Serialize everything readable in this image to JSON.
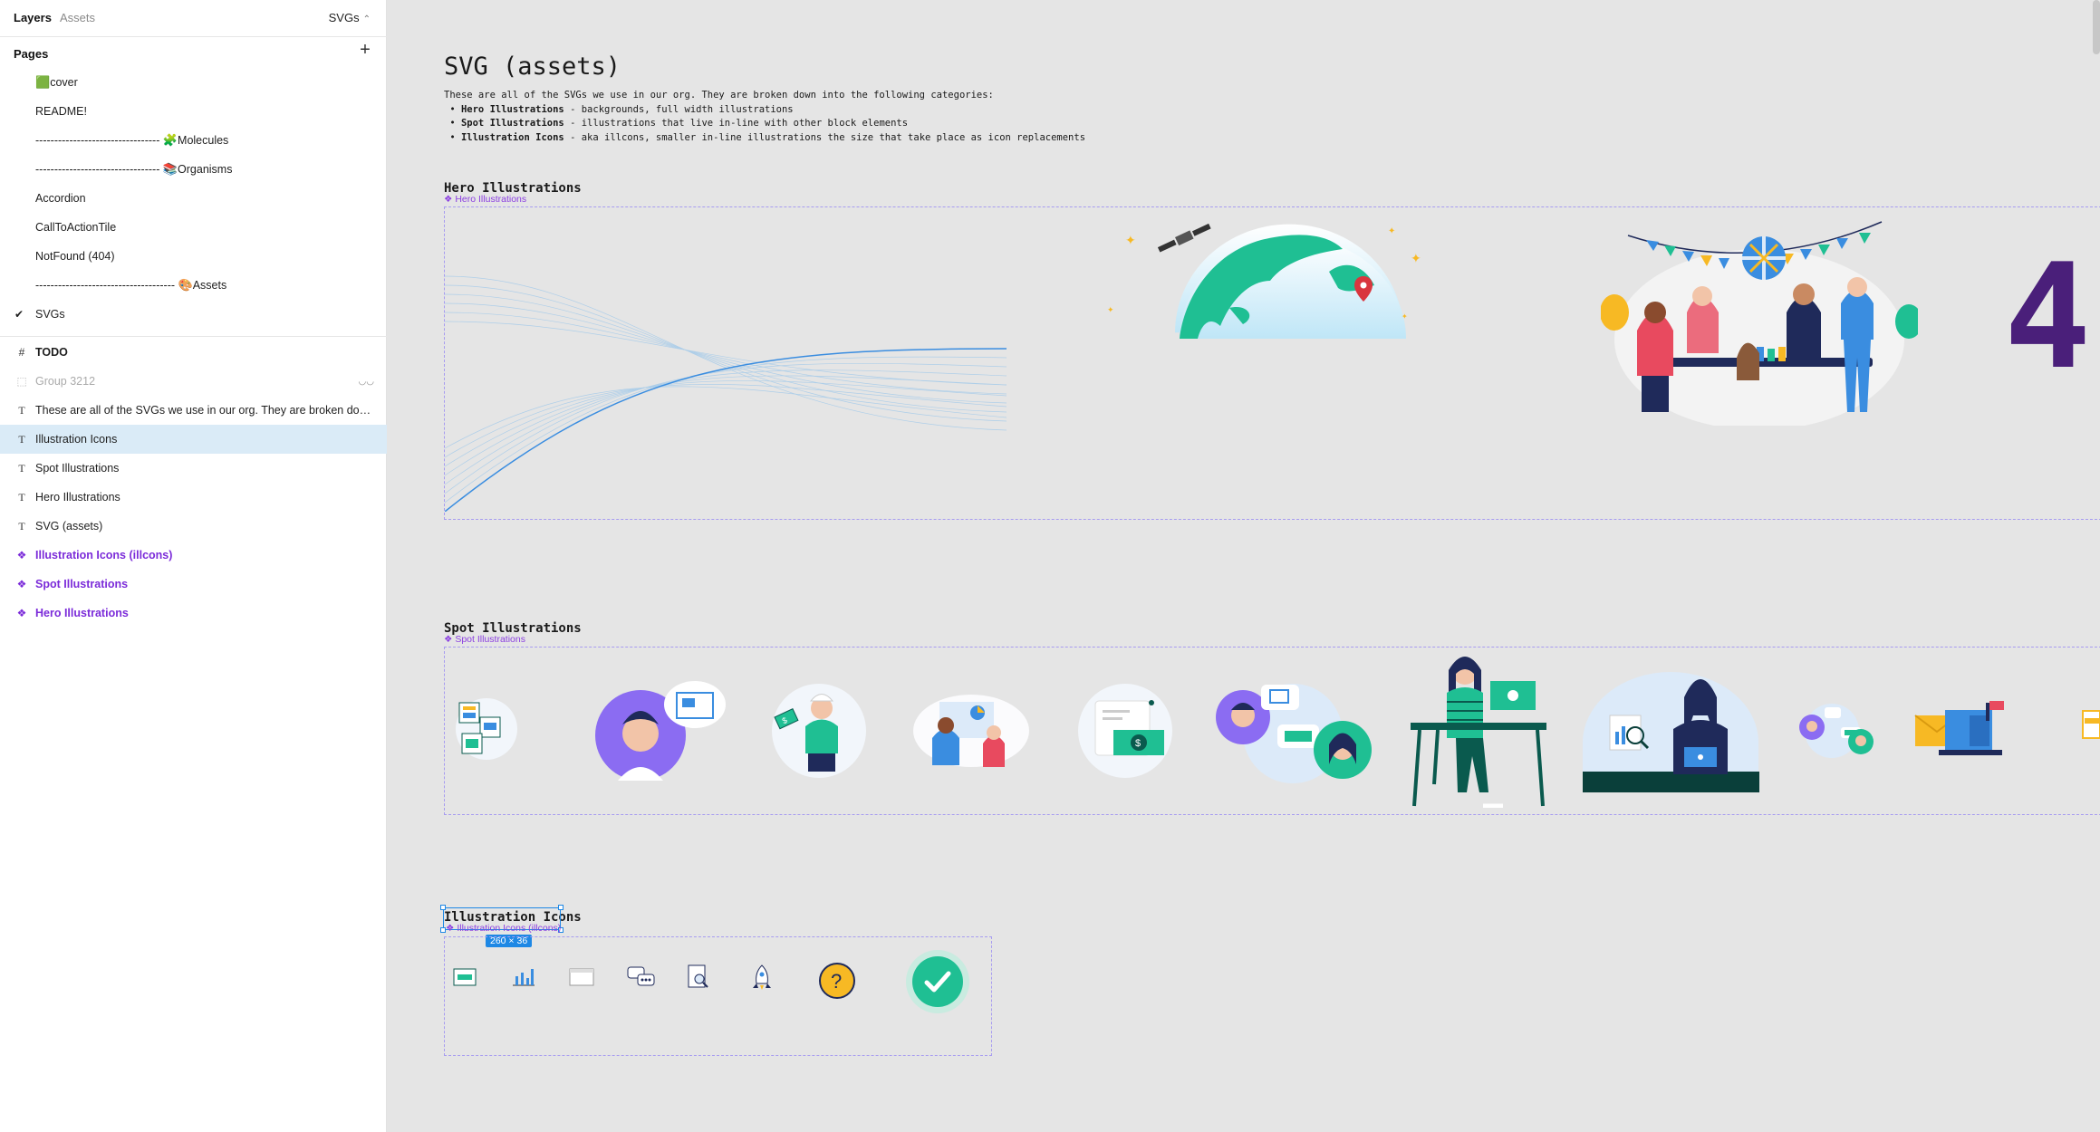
{
  "sidebar": {
    "tabs": {
      "layers": "Layers",
      "assets": "Assets"
    },
    "page_switcher": "SVGs",
    "pages_title": "Pages",
    "pages": [
      {
        "emoji": "🟩",
        "label": "cover"
      },
      {
        "emoji": "",
        "label": "README!"
      },
      {
        "emoji": "🧩",
        "label": "--------------------------------- ",
        "suffix": "Molecules"
      },
      {
        "emoji": "📚",
        "label": "--------------------------------- ",
        "suffix": "Organisms"
      },
      {
        "emoji": "",
        "label": "Accordion"
      },
      {
        "emoji": "",
        "label": "CallToActionTile"
      },
      {
        "emoji": "",
        "label": "NotFound (404)"
      },
      {
        "emoji": "🎨",
        "label": "------------------------------------- ",
        "suffix": "Assets"
      },
      {
        "emoji": "",
        "label": "SVGs",
        "current": true
      }
    ],
    "layers": [
      {
        "icon": "#",
        "label": "TODO"
      },
      {
        "icon": "⬚",
        "label": "Group 3212"
      },
      {
        "icon": "T",
        "label": "These are all of the SVGs we use in our org. They are broken down int..."
      },
      {
        "icon": "T",
        "label": "Illustration Icons"
      },
      {
        "icon": "T",
        "label": "Spot Illustrations"
      },
      {
        "icon": "T",
        "label": "Hero Illustrations"
      },
      {
        "icon": "T",
        "label": "SVG (assets)"
      },
      {
        "icon": "❖",
        "label": "Illustration Icons (illcons)"
      },
      {
        "icon": "❖",
        "label": "Spot Illustrations"
      },
      {
        "icon": "❖",
        "label": "Hero Illustrations"
      }
    ]
  },
  "canvas": {
    "title": "SVG (assets)",
    "desc": {
      "intro": "These are all of the SVGs we use in our org. They are broken down into the following categories:",
      "items": [
        {
          "name": "Hero Illustrations",
          "text": " - backgrounds, full width illustrations"
        },
        {
          "name": "Spot Illustrations",
          "text": " - illustrations that live in-line with other block elements"
        },
        {
          "name": "Illustration Icons",
          "text": " - aka illcons, smaller in-line illustrations the size that take place as icon replacements"
        }
      ]
    },
    "hero": {
      "heading": "Hero Illustrations",
      "tag": "Hero Illustrations",
      "big_char": "4"
    },
    "spot": {
      "heading": "Spot Illustrations",
      "tag": "Spot Illustrations"
    },
    "illcons": {
      "heading": "Illustration Icons",
      "tag": "Illustration Icons (illcons)",
      "size_badge": "260 × 36"
    },
    "colors": {
      "teal": "#1fbf93",
      "dark_teal": "#0a5a4e",
      "purple": "#8b6cf2",
      "coral": "#e84a5f",
      "navy": "#1f2a5a",
      "yellow": "#f7b924",
      "blue": "#3a8de0",
      "light_blue": "#dceaf9"
    }
  }
}
